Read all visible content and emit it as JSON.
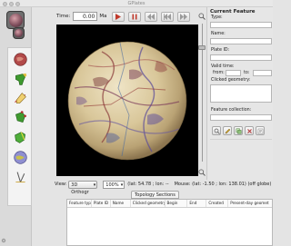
{
  "window": {
    "title": "GPlates"
  },
  "toolbar": {
    "time_label": "Time:",
    "time_value": "0.00",
    "time_unit": "Ma",
    "buttons": [
      "play-icon",
      "stop-icon",
      "rewind-icon",
      "step-back-icon",
      "step-forward-icon"
    ]
  },
  "view_bar": {
    "view_label": "View:",
    "projection": "3D Orthogr",
    "zoom_percent": "100%",
    "camera_readout": "(lat: 54.78 ; lon: --",
    "mouse_readout": "Mouse: (lat: -1.50 ; lon: 138.01) (off globe)"
  },
  "feature_panel": {
    "title": "Current Feature",
    "type_label": "Type:",
    "name_label": "Name:",
    "plate_id_label": "Plate ID:",
    "valid_time_label": "Valid time:",
    "from_label": "from:",
    "to_label": "to:",
    "clicked_geometry_label": "Clicked geometry:",
    "feature_collection_label": "Feature collection:"
  },
  "topology": {
    "tab_label": "Topology Sections",
    "columns": [
      "Feature type",
      "Plate ID",
      "Name",
      "Clicked geometry",
      "Begin",
      "End",
      "Created",
      "Present-day geomet"
    ]
  },
  "colors": {
    "canvas_background": "#000000",
    "panel_background": "#e6e6e6",
    "toolbar_button_play": "#c0392b"
  }
}
